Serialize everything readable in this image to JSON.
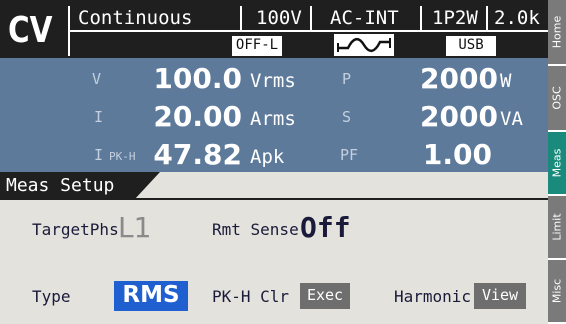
{
  "header": {
    "mode": "CV",
    "output_mode": "Continuous",
    "range": "100V",
    "source": "AC-INT",
    "wiring": "1P2W",
    "freq_range": "2.0k",
    "output_state": "OFF-L",
    "interface": "USB",
    "waveform_icon": "sine-wave-icon"
  },
  "measurements": [
    {
      "label": "V",
      "sub": "",
      "value": "100.0",
      "unit": "Vrms"
    },
    {
      "label": "I",
      "sub": "",
      "value": "20.00",
      "unit": "Arms"
    },
    {
      "label": "I",
      "sub": "PK-H",
      "value": "47.82",
      "unit": "Apk"
    },
    {
      "label": "P",
      "sub": "",
      "value": "2000",
      "unit": "W"
    },
    {
      "label": "S",
      "sub": "",
      "value": "2000",
      "unit": "VA"
    },
    {
      "label": "PF",
      "sub": "",
      "value": "1.00",
      "unit": ""
    }
  ],
  "setup": {
    "title": "Meas Setup",
    "target_label": "TargetPhs",
    "target_value": "L1",
    "rmt_sense_label": "Rmt Sense",
    "rmt_sense_value": "Off",
    "type_label": "Type",
    "type_value": "RMS",
    "pkh_label": "PK-H Clr",
    "pkh_button": "Exec",
    "harmonic_label": "Harmonic",
    "harmonic_button": "View"
  },
  "tabs": [
    {
      "label": "Home",
      "active": false
    },
    {
      "label": "OSC",
      "active": false
    },
    {
      "label": "Meas",
      "active": true
    },
    {
      "label": "Limit",
      "active": false
    },
    {
      "label": "Misc",
      "active": false
    }
  ],
  "colors": {
    "header_bg": "#1f1f1f",
    "meas_bg": "#5d7a9b",
    "setup_bg": "#e3e2dc",
    "selected": "#1f5fcf",
    "active_tab": "#1a8a7c"
  }
}
